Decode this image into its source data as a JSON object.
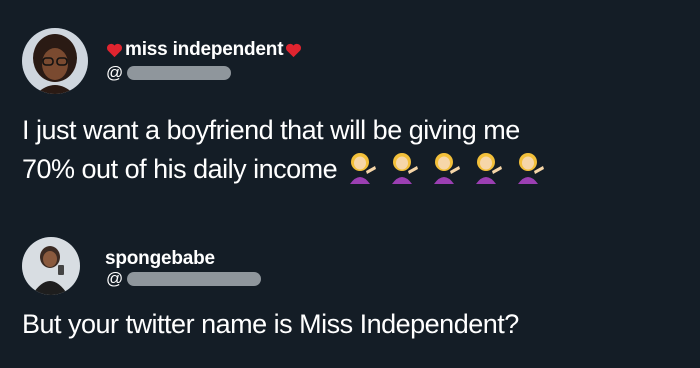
{
  "tweets": [
    {
      "display_name": "miss independent",
      "handle_prefix": "@",
      "text_line1": "I just want a boyfriend that will be giving me",
      "text_line2": "70% out of his daily income",
      "emoji_icons": [
        "woman-tipping-hand-icon",
        "woman-tipping-hand-icon",
        "woman-tipping-hand-icon",
        "woman-tipping-hand-icon",
        "woman-tipping-hand-icon"
      ],
      "name_decoration_icon": "red-heart-icon"
    },
    {
      "display_name": "spongebabe",
      "handle_prefix": "@",
      "text_line1": "But your twitter name is Miss Independent?"
    }
  ],
  "colors": {
    "background": "#141d26",
    "text": "#ffffff",
    "handle_blur": "#8f969c",
    "heart": "#e0242f"
  }
}
